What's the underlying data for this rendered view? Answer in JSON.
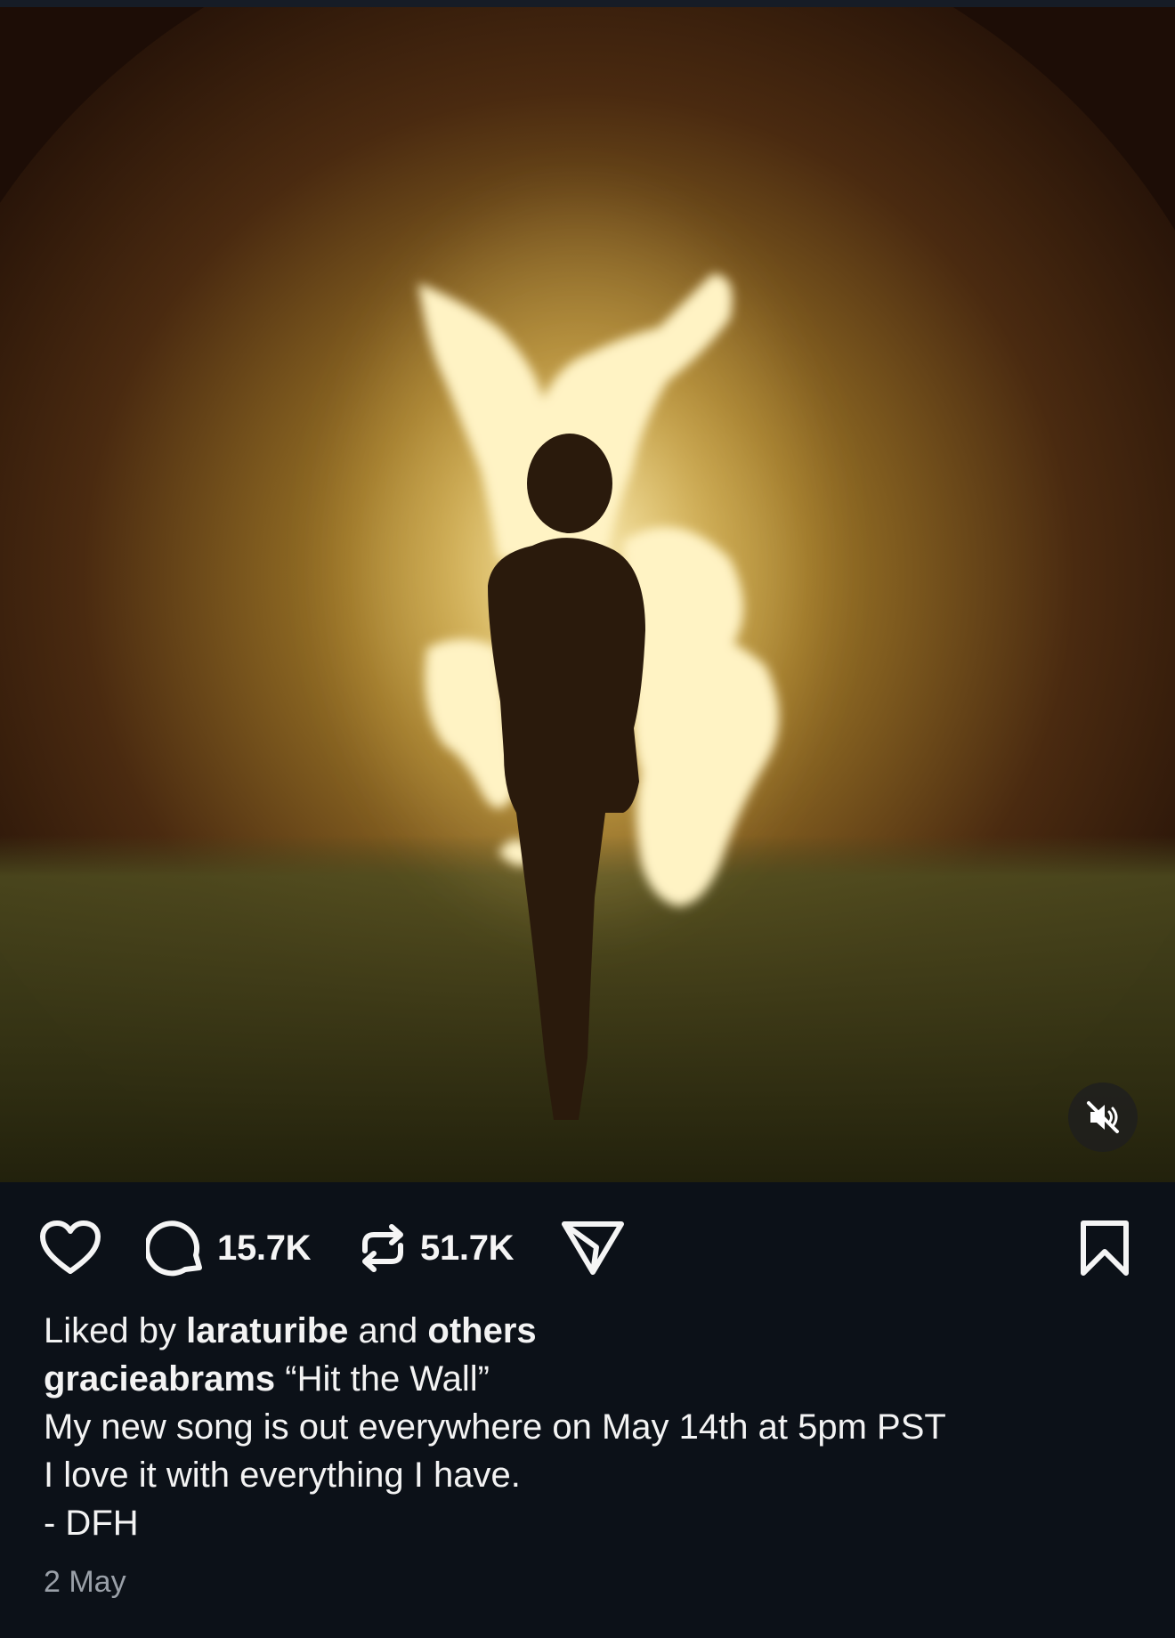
{
  "post": {
    "media": {
      "muted": true,
      "mute_icon": "speaker-muted-icon"
    },
    "actions": {
      "like_icon": "heart-icon",
      "comment_icon": "comment-bubble-icon",
      "comment_count": "15.7K",
      "repost_icon": "repost-icon",
      "repost_count": "51.7K",
      "share_icon": "paper-plane-icon",
      "save_icon": "bookmark-icon"
    },
    "liked_by": {
      "prefix": "Liked by",
      "user": "laraturibe",
      "conjunction": "and",
      "others": "others"
    },
    "caption": {
      "username": "gracieabrams",
      "title": " “Hit the Wall”",
      "lines": [
        "My new song is out everywhere on May 14th at 5pm PST",
        "I love it with everything I have.",
        "- DFH"
      ]
    },
    "date": "2 May"
  },
  "colors": {
    "background": "#0c1118",
    "text": "#f5f5f5",
    "secondary_text": "#9aa0a8",
    "fire": "#fff1b8"
  }
}
